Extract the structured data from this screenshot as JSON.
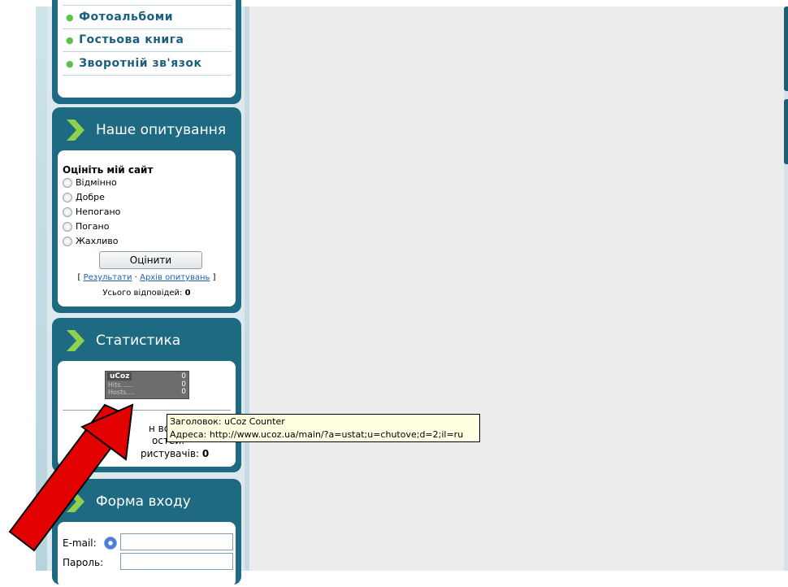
{
  "sidebar_menu": {
    "items": [
      {
        "label": "Фотоальбоми"
      },
      {
        "label": "Гостьова книга"
      },
      {
        "label": "Зворотній зв'язок"
      }
    ]
  },
  "poll": {
    "title": "Наше опитування",
    "question": "Оцініть мій сайт",
    "options": [
      "Відмінно",
      "Добре",
      "Непогано",
      "Погано",
      "Жахливо"
    ],
    "vote_button": "Оцінити",
    "bracket_open": "[",
    "results_link": "Результати",
    "separator": "·",
    "archive_link": "Архів опитувань",
    "bracket_close": "]",
    "total_label": "Усього відповідей:",
    "total_value": "0"
  },
  "statistics": {
    "title": "Статистика",
    "counter": {
      "brand": "uCoz",
      "value": "0",
      "hits_label": "Hits......",
      "hits_value": "0",
      "hosts_label": "Hosts....",
      "hosts_value": "0"
    },
    "line1_partial": "н всьо",
    "line2_partial": "остей:",
    "line3_label": "ристувачів:",
    "line3_value": "0"
  },
  "tooltip": {
    "line1": "Заголовок: uCoz Counter",
    "line2": "Адреса: http://www.ucoz.ua/main/?a=ustat;u=chutove;d=2;il=ru"
  },
  "login": {
    "title": "Форма входу",
    "email_label": "E-mail:",
    "password_label": "Пароль:"
  },
  "colors": {
    "block_bg": "#1e6a82",
    "menu_text": "#1a5f80",
    "annotation_arrow": "#e30000"
  }
}
